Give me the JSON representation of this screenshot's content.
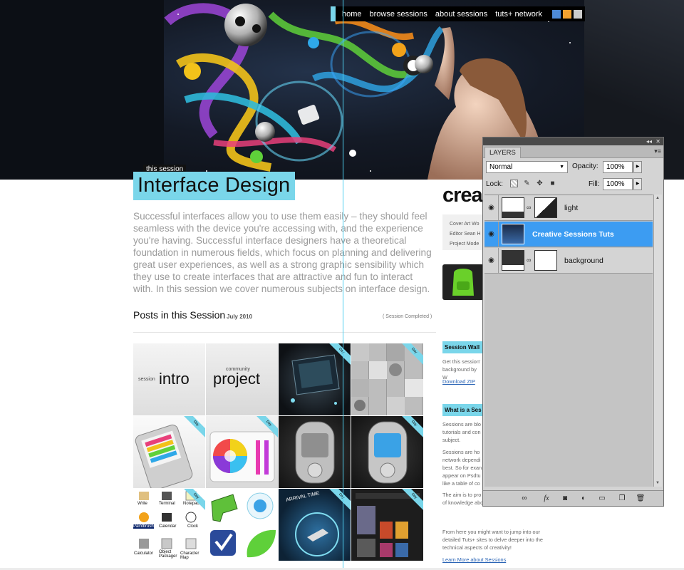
{
  "nav": {
    "items": [
      "home",
      "browse sessions",
      "about sessions",
      "tuts+ network"
    ],
    "icon_colors": [
      "#4d8ad8",
      "#f0a030",
      "#cccccc"
    ]
  },
  "session": {
    "tag": "this session",
    "title": "Interface Design",
    "intro": "Successful interfaces allow you to use them easily – they should feel seamless with the device you're accessing with, and the experience you're having. Successful interface designers have a theoretical foundation in numerous fields, which focus on planning and delivering great user experiences, as well as a strong graphic sensibility which they use to create interfaces that are attractive and fun to interact with. In this session we cover numerous subjects on interface design.",
    "posts_heading": "Posts in this Session",
    "posts_date": "July 2010",
    "posts_status": "( Session Completed )"
  },
  "grid": {
    "intro_small": "session",
    "intro_big": "intro",
    "comm_small": "community",
    "comm_big": "project",
    "ribbon": "Day",
    "icon_labels": [
      "Write",
      "Terminal",
      "Notepad",
      "Paintbrush",
      "Calendar",
      "Clock",
      "Calculator",
      "Object Packager",
      "Character Map"
    ],
    "arrival_label": "ARRIVAL TIME"
  },
  "sidebar": {
    "crea": "crea",
    "cover_lines": [
      "Cover Art Wo",
      "Editor Sean H",
      "Project Mode"
    ],
    "wallpaper_h": "Session Wall",
    "wallpaper_p": "Get this session' background by W",
    "download": "Download ZIP",
    "what_h": "What is a Ses",
    "what_p1": "Sessions are blo tutorials and con subject.",
    "what_p2": "Sessions are ho network dependi best. So for exan appear on Psdtu like a table of co",
    "what_p3": "The aim is to pro courses on differ get a variety of knowledge about the creative fields.",
    "what_p4": "From here you might want to jump into our detailed Tuts+ sites to delve deeper into the technical aspects of creativity!",
    "learn_more": "Learn More about Sessions"
  },
  "layers_panel": {
    "tab": "LAYERS",
    "blend_mode": "Normal",
    "opacity_label": "Opacity:",
    "opacity": "100%",
    "lock_label": "Lock:",
    "fill_label": "Fill:",
    "fill": "100%",
    "layers": [
      {
        "name": "light",
        "selected": false
      },
      {
        "name": "Creative Sessions   Tuts",
        "selected": true
      },
      {
        "name": "background",
        "selected": false
      }
    ]
  },
  "colors": {
    "accent": "#7ad6ea",
    "selection": "#3c9cf2",
    "guide": "#4fd0f0"
  }
}
